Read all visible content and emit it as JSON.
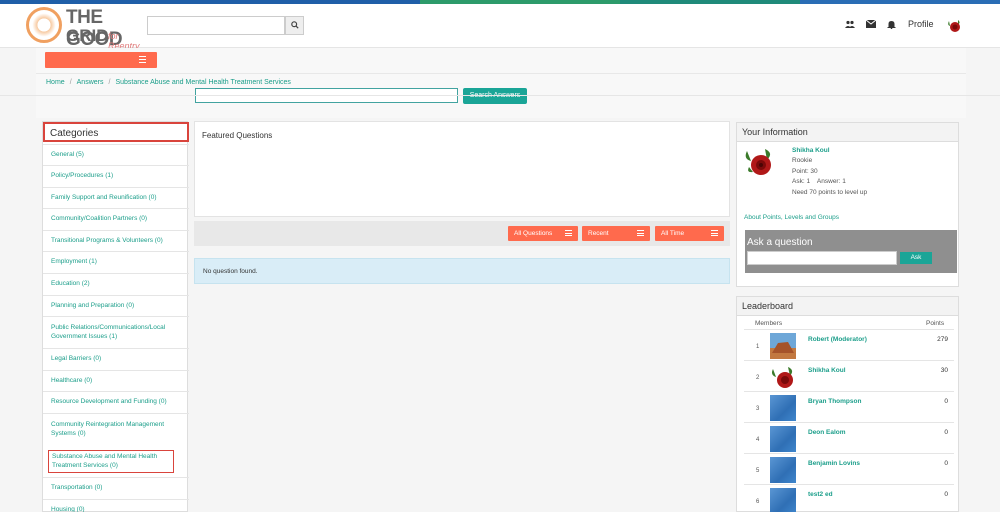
{
  "brand": {
    "line1": "THE GOOD",
    "line2": "GRID",
    "tagline": "for Reentry"
  },
  "header": {
    "search_placeholder": "",
    "profile_label": "Profile",
    "icons": [
      "search-icon",
      "users-icon",
      "envelope-icon",
      "bell-icon"
    ]
  },
  "breadcrumb": [
    "Home",
    "Answers",
    "Substance Abuse and Mental Health Treatment Services"
  ],
  "answers_search": {
    "placeholder": "",
    "button": "Search Answers"
  },
  "categories": {
    "title": "Categories",
    "items": [
      "General (5)",
      "Policy/Procedures (1)",
      "Family Support and Reunification (0)",
      "Community/Coalition Partners (0)",
      "Transitional Programs & Volunteers (0)",
      "Employment (1)",
      "Education (2)",
      "Planning and Preparation (0)",
      "Public Relations/Communications/Local Government Issues (1)",
      "Legal Barriers (0)",
      "Healthcare (0)",
      "Resource Development and Funding (0)",
      "Community Reintegration Management Systems (0)",
      "Substance Abuse and Mental Health Treatment Services (0)",
      "Transportation (0)",
      "Housing (0)"
    ]
  },
  "featured": {
    "title": "Featured Questions",
    "empty_message": "No question found."
  },
  "filters": [
    "All Questions",
    "Recent",
    "All Time"
  ],
  "your_info": {
    "title": "Your Information",
    "name": "Shikha Koul",
    "rank": "Rookie",
    "points": "Point: 30",
    "ask_answer": "Ask: 1    Answer: 1",
    "next_level": "Need 70 points to level up",
    "about_link": "About Points, Levels and Groups",
    "ask_title": "Ask a question",
    "ask_button": "Ask"
  },
  "leaderboard": {
    "title": "Leaderboard",
    "col_members": "Members",
    "col_points": "Points",
    "rows": [
      {
        "rank": "1",
        "name": "Robert (Moderator)",
        "points": "279",
        "avatar": "landscape"
      },
      {
        "rank": "2",
        "name": "Shikha Koul",
        "points": "30",
        "avatar": "rose"
      },
      {
        "rank": "3",
        "name": "Bryan Thompson",
        "points": "0",
        "avatar": "blue"
      },
      {
        "rank": "4",
        "name": "Deon Ealom",
        "points": "0",
        "avatar": "blue"
      },
      {
        "rank": "5",
        "name": "Benjamin Lovins",
        "points": "0",
        "avatar": "blue"
      },
      {
        "rank": "6",
        "name": "test2 ed",
        "points": "0",
        "avatar": "blue"
      }
    ]
  },
  "colors": {
    "accent": "#ff6a4d",
    "teal": "#1aa597",
    "link": "#1b9e8a",
    "highlight": "#d9443c"
  }
}
